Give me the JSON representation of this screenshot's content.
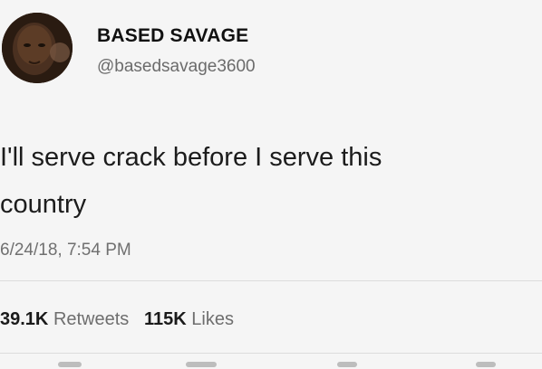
{
  "tweet": {
    "display_name": "BASED SAVAGE",
    "handle": "@basedsavage3600",
    "text_line1": "I'll serve crack before I serve this",
    "text_line2": "country",
    "timestamp": "6/24/18, 7:54 PM",
    "retweets_count": "39.1K",
    "retweets_label": "Retweets",
    "likes_count": "115K",
    "likes_label": "Likes"
  },
  "icons": {
    "avatar": "profile-photo",
    "action_row": [
      "reply-icon",
      "retweet-icon",
      "like-icon",
      "share-icon"
    ]
  }
}
